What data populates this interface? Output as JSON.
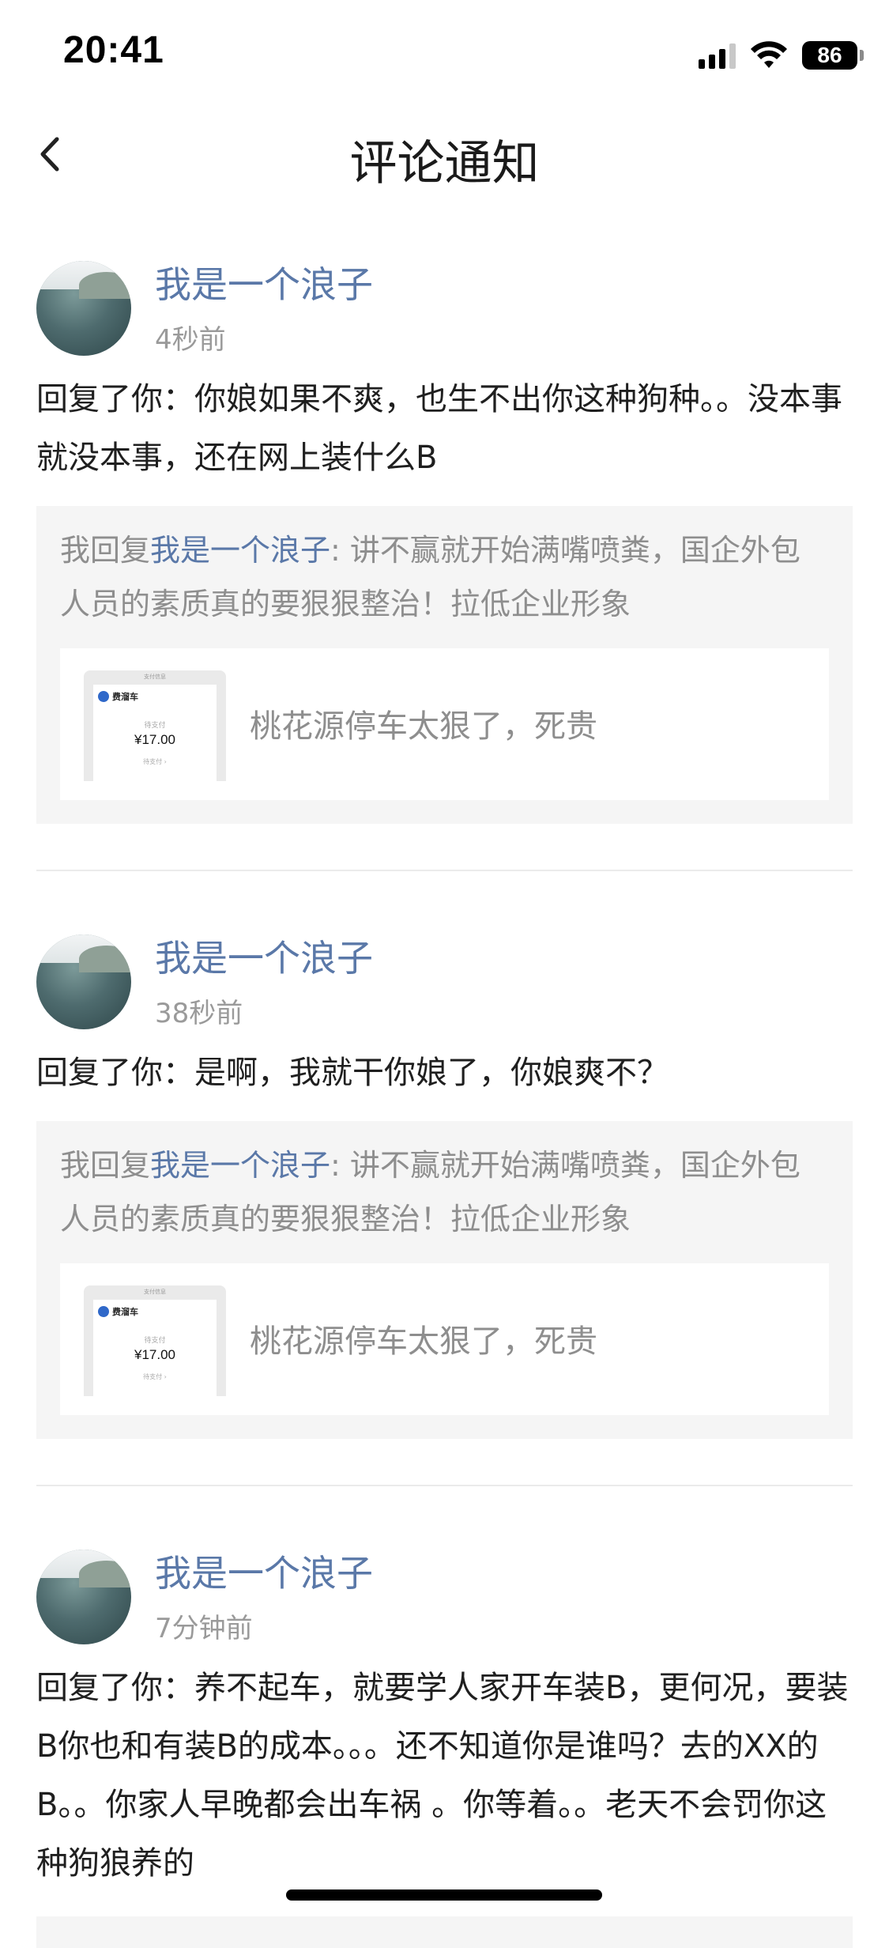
{
  "status_bar": {
    "time": "20:41",
    "battery": "86",
    "icons": [
      "signal-icon",
      "wifi-icon",
      "battery-icon"
    ]
  },
  "nav": {
    "title": "评论通知",
    "back_icon": "chevron-left-icon"
  },
  "colors": {
    "link": "#5a78a8",
    "meta": "#9a9a9a",
    "quote_bg": "#f5f5f5"
  },
  "notices": [
    {
      "user": "我是一个浪子",
      "time": "4秒前",
      "comment": "回复了你：你娘如果不爽，也生不出你这种狗种。。没本事就没本事，还在网上装什么B",
      "quote_prefix": "我回复",
      "quote_name": "我是一个浪子",
      "quote_body": ": 讲不赢就开始满嘴喷粪，国企外包人员的素质真的要狠狠整治！拉低企业形象",
      "post_title": "桃花源停车太狠了，死贵",
      "thumb": {
        "header": "支付信息",
        "brand": "费溜车",
        "sub": "待支付",
        "amount": "¥17.00",
        "foot": "待支付 ›"
      }
    },
    {
      "user": "我是一个浪子",
      "time": "38秒前",
      "comment": "回复了你：是啊，我就干你娘了，你娘爽不？",
      "quote_prefix": "我回复",
      "quote_name": "我是一个浪子",
      "quote_body": ": 讲不赢就开始满嘴喷粪，国企外包人员的素质真的要狠狠整治！拉低企业形象",
      "post_title": "桃花源停车太狠了，死贵",
      "thumb": {
        "header": "支付信息",
        "brand": "费溜车",
        "sub": "待支付",
        "amount": "¥17.00",
        "foot": "待支付 ›"
      }
    },
    {
      "user": "我是一个浪子",
      "time": "7分钟前",
      "comment": "回复了你：养不起车，就要学人家开车装B，更何况，要装B你也和有装B的成本。。。还不知道你是谁吗？去的XX的B。。你家人早晚都会出车祸 。你等着。。老天不会罚你这种狗狼养的"
    }
  ]
}
